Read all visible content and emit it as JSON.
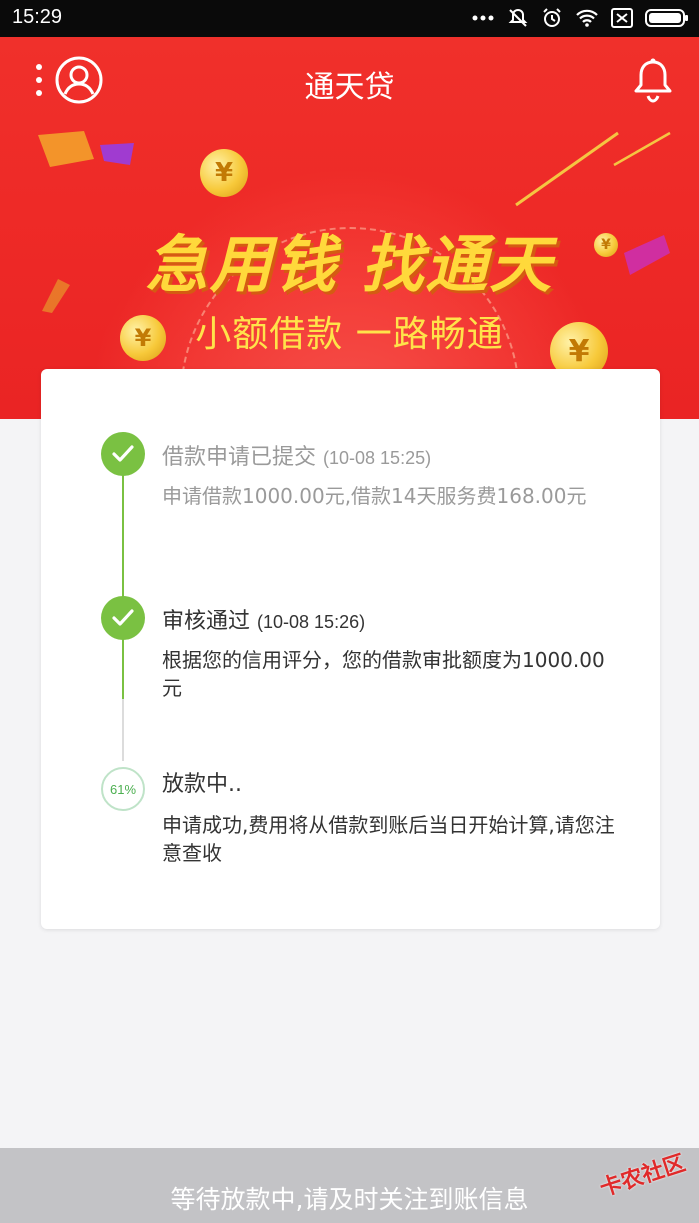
{
  "status_bar": {
    "time": "15:29"
  },
  "header": {
    "title": "通天贷"
  },
  "banner": {
    "slogan": "急用钱 找通天",
    "subslogan": "小额借款 一路畅通",
    "coin_glyph": "¥"
  },
  "steps": [
    {
      "title": "借款申请已提交",
      "time": "(10-08 15:25)",
      "desc": "申请借款1000.00元,借款14天服务费168.00元",
      "status": "done-muted"
    },
    {
      "title": "审核通过",
      "time": "(10-08 15:26)",
      "desc": "根据您的信用评分，您的借款审批额度为1000.00元",
      "status": "done"
    },
    {
      "title": "放款中..",
      "progress": "61%",
      "desc": "申请成功,费用将从借款到账后当日开始计算,请您注意查收",
      "status": "in-progress"
    }
  ],
  "bottom": {
    "message": "等待放款中,请及时关注到账信息"
  },
  "watermark": "卡农社区",
  "colors": {
    "brand_red": "#ee2a27",
    "success_green": "#7ac142",
    "slogan_yellow": "#ffd93b"
  }
}
